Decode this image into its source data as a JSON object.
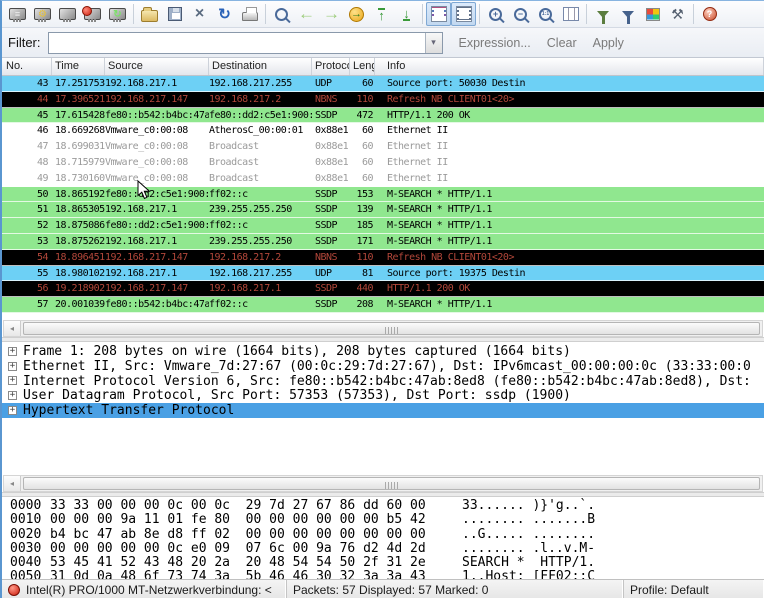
{
  "colors": {
    "udp": "#6dd0f5",
    "ssdp": "#90e78f",
    "err_bg": "#000000",
    "err_fg": "#b2473a",
    "dim": "#9a9a9a",
    "selected": "#4aa0e4"
  },
  "toolbar": {
    "items": [
      "interfaces",
      "capture-options",
      "capture-start",
      "capture-stop",
      "capture-restart",
      "|",
      "open",
      "save",
      "close",
      "reload",
      "print",
      "|",
      "find",
      "go-back",
      "go-forward",
      "go-to-packet",
      "go-to-top",
      "go-to-bottom",
      "|",
      "colorize",
      "autoscroll",
      "|",
      "zoom-in",
      "zoom-out",
      "zoom-1-1",
      "resize-columns",
      "|",
      "capture-filters",
      "display-filters",
      "coloring-rules",
      "preferences",
      "|",
      "help"
    ],
    "pressed": [
      "colorize",
      "autoscroll"
    ]
  },
  "filter": {
    "label": "Filter:",
    "value": "",
    "expression_label": "Expression...",
    "clear_label": "Clear",
    "apply_label": "Apply"
  },
  "packet_list": {
    "columns": [
      {
        "key": "no",
        "label": "No."
      },
      {
        "key": "time",
        "label": "Time"
      },
      {
        "key": "source",
        "label": "Source"
      },
      {
        "key": "destination",
        "label": "Destination"
      },
      {
        "key": "protocol",
        "label": "Protocol"
      },
      {
        "key": "length",
        "label": "Length"
      },
      {
        "key": "info",
        "label": "Info"
      }
    ],
    "rows": [
      {
        "no": "43",
        "time": "17.251753",
        "source": "192.168.217.1",
        "destination": "192.168.217.255",
        "protocol": "UDP",
        "length": "60",
        "info": "Source port: 50030  Destin",
        "style": "udp"
      },
      {
        "no": "44",
        "time": "17.396521",
        "source": "192.168.217.147",
        "destination": "192.168.217.2",
        "protocol": "NBNS",
        "length": "110",
        "info": "Refresh NB CLIENT01<20>",
        "style": "err"
      },
      {
        "no": "45",
        "time": "17.615428",
        "source": "fe80::b542:b4bc:47a",
        "destination": "fe80::dd2:c5e1:900:",
        "protocol": "SSDP",
        "length": "472",
        "info": "HTTP/1.1 200 OK",
        "style": "ssdp"
      },
      {
        "no": "46",
        "time": "18.669268",
        "source": "Vmware_c0:00:08",
        "destination": "AtherosC_00:00:01",
        "protocol": "0x88e1",
        "length": "60",
        "info": "Ethernet II",
        "style": "plain"
      },
      {
        "no": "47",
        "time": "18.699031",
        "source": "Vmware_c0:00:08",
        "destination": "Broadcast",
        "protocol": "0x88e1",
        "length": "60",
        "info": "Ethernet II",
        "style": "dim"
      },
      {
        "no": "48",
        "time": "18.715979",
        "source": "Vmware_c0:00:08",
        "destination": "Broadcast",
        "protocol": "0x88e1",
        "length": "60",
        "info": "Ethernet II",
        "style": "dim"
      },
      {
        "no": "49",
        "time": "18.730160",
        "source": "Vmware_c0:00:08",
        "destination": "Broadcast",
        "protocol": "0x88e1",
        "length": "60",
        "info": "Ethernet II",
        "style": "dim"
      },
      {
        "no": "50",
        "time": "18.865192",
        "source": "fe80::dd2:c5e1:900:",
        "destination": "ff02::c",
        "protocol": "SSDP",
        "length": "153",
        "info": "M-SEARCH * HTTP/1.1",
        "style": "ssdp"
      },
      {
        "no": "51",
        "time": "18.865305",
        "source": "192.168.217.1",
        "destination": "239.255.255.250",
        "protocol": "SSDP",
        "length": "139",
        "info": "M-SEARCH * HTTP/1.1",
        "style": "ssdp"
      },
      {
        "no": "52",
        "time": "18.875086",
        "source": "fe80::dd2:c5e1:900:",
        "destination": "ff02::c",
        "protocol": "SSDP",
        "length": "185",
        "info": "M-SEARCH * HTTP/1.1",
        "style": "ssdp"
      },
      {
        "no": "53",
        "time": "18.875262",
        "source": "192.168.217.1",
        "destination": "239.255.255.250",
        "protocol": "SSDP",
        "length": "171",
        "info": "M-SEARCH * HTTP/1.1",
        "style": "ssdp"
      },
      {
        "no": "54",
        "time": "18.896451",
        "source": "192.168.217.147",
        "destination": "192.168.217.2",
        "protocol": "NBNS",
        "length": "110",
        "info": "Refresh NB CLIENT01<20>",
        "style": "err"
      },
      {
        "no": "55",
        "time": "18.980102",
        "source": "192.168.217.1",
        "destination": "192.168.217.255",
        "protocol": "UDP",
        "length": "81",
        "info": "Source port: 19375  Destin",
        "style": "udp"
      },
      {
        "no": "56",
        "time": "19.218902",
        "source": "192.168.217.147",
        "destination": "192.168.217.1",
        "protocol": "SSDP",
        "length": "440",
        "info": "HTTP/1.1 200 OK",
        "style": "err"
      },
      {
        "no": "57",
        "time": "20.001039",
        "source": "fe80::b542:b4bc:47a",
        "destination": "ff02::c",
        "protocol": "SSDP",
        "length": "208",
        "info": "M-SEARCH * HTTP/1.1",
        "style": "ssdp"
      }
    ]
  },
  "details": {
    "rows": [
      {
        "text": "Frame 1: 208 bytes on wire (1664 bits), 208 bytes captured (1664 bits)",
        "selected": false
      },
      {
        "text": "Ethernet II, Src: Vmware_7d:27:67 (00:0c:29:7d:27:67), Dst: IPv6mcast_00:00:00:0c (33:33:00:0",
        "selected": false
      },
      {
        "text": "Internet Protocol Version 6, Src: fe80::b542:b4bc:47ab:8ed8 (fe80::b542:b4bc:47ab:8ed8), Dst:",
        "selected": false
      },
      {
        "text": "User Datagram Protocol, Src Port: 57353 (57353), Dst Port: ssdp (1900)",
        "selected": false
      },
      {
        "text": "Hypertext Transfer Protocol",
        "selected": true
      }
    ]
  },
  "hex_dump": {
    "rows": [
      {
        "offset": "0000",
        "bytes": "33 33 00 00 00 0c 00 0c  29 7d 27 67 86 dd 60 00",
        "ascii": "33...... )}'g..`."
      },
      {
        "offset": "0010",
        "bytes": "00 00 00 9a 11 01 fe 80  00 00 00 00 00 00 b5 42",
        "ascii": "........ .......B"
      },
      {
        "offset": "0020",
        "bytes": "b4 bc 47 ab 8e d8 ff 02  00 00 00 00 00 00 00 00",
        "ascii": "..G..... ........"
      },
      {
        "offset": "0030",
        "bytes": "00 00 00 00 00 0c e0 09  07 6c 00 9a 76 d2 4d 2d",
        "ascii": "........ .l..v.M-"
      },
      {
        "offset": "0040",
        "bytes": "53 45 41 52 43 48 20 2a  20 48 54 54 50 2f 31 2e",
        "ascii": "SEARCH *  HTTP/1."
      },
      {
        "offset": "0050",
        "bytes": "31 0d 0a 48 6f 73 74 3a  5b 46 46 30 32 3a 3a 43",
        "ascii": "1..Host: [FF02::C"
      }
    ]
  },
  "status": {
    "interface": "Intel(R) PRO/1000 MT-Netzwerkverbindung: <",
    "packets": "Packets: 57 Displayed: 57 Marked: 0",
    "profile": "Profile: Default"
  }
}
